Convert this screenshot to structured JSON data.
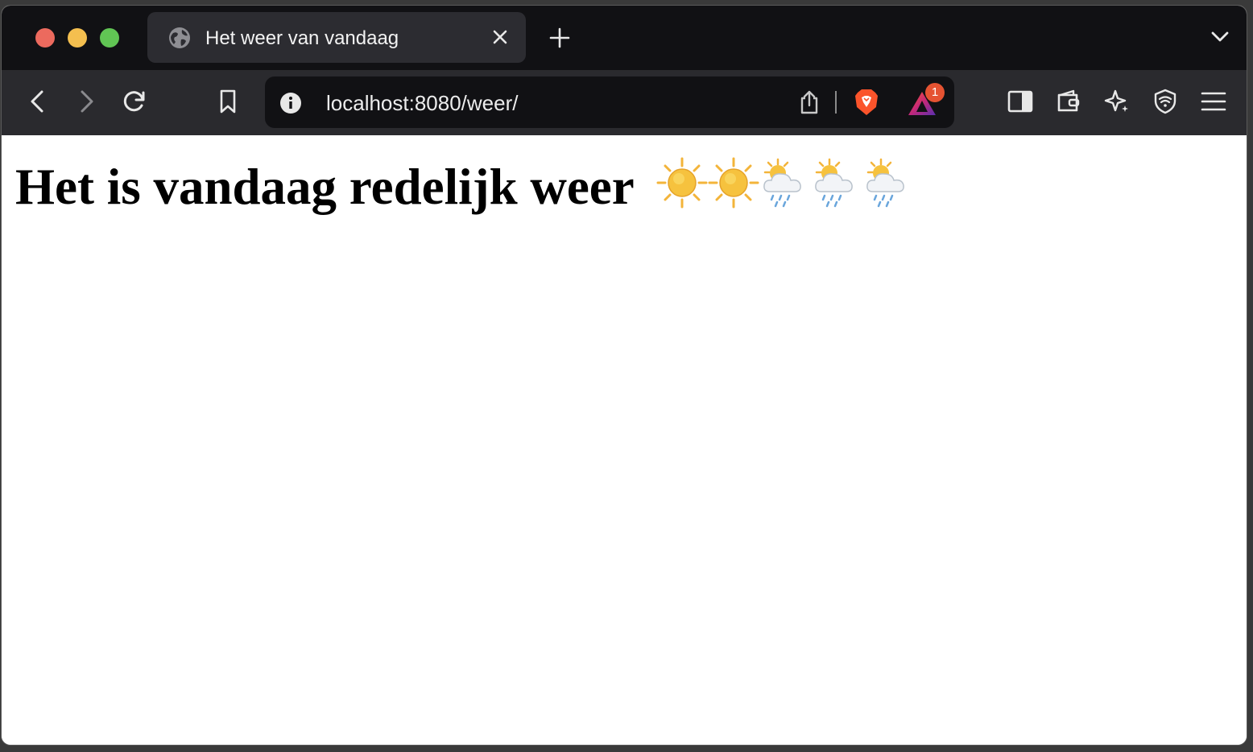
{
  "browser": {
    "tab": {
      "title": "Het weer van vandaag"
    },
    "address_bar": {
      "url": "localhost:8080/weer/"
    },
    "rewards_badge": "1"
  },
  "page": {
    "heading": "Het is vandaag redelijk weer",
    "weather_icons": [
      "sun-icon",
      "sun-icon",
      "sun-behind-rain-cloud-icon",
      "sun-behind-rain-cloud-icon",
      "sun-behind-rain-cloud-icon"
    ]
  },
  "colors": {
    "tabbar_bg": "#111114",
    "toolbar_bg": "#2a2a2e",
    "brave_orange": "#fb542b",
    "badge_red": "#e55332"
  }
}
